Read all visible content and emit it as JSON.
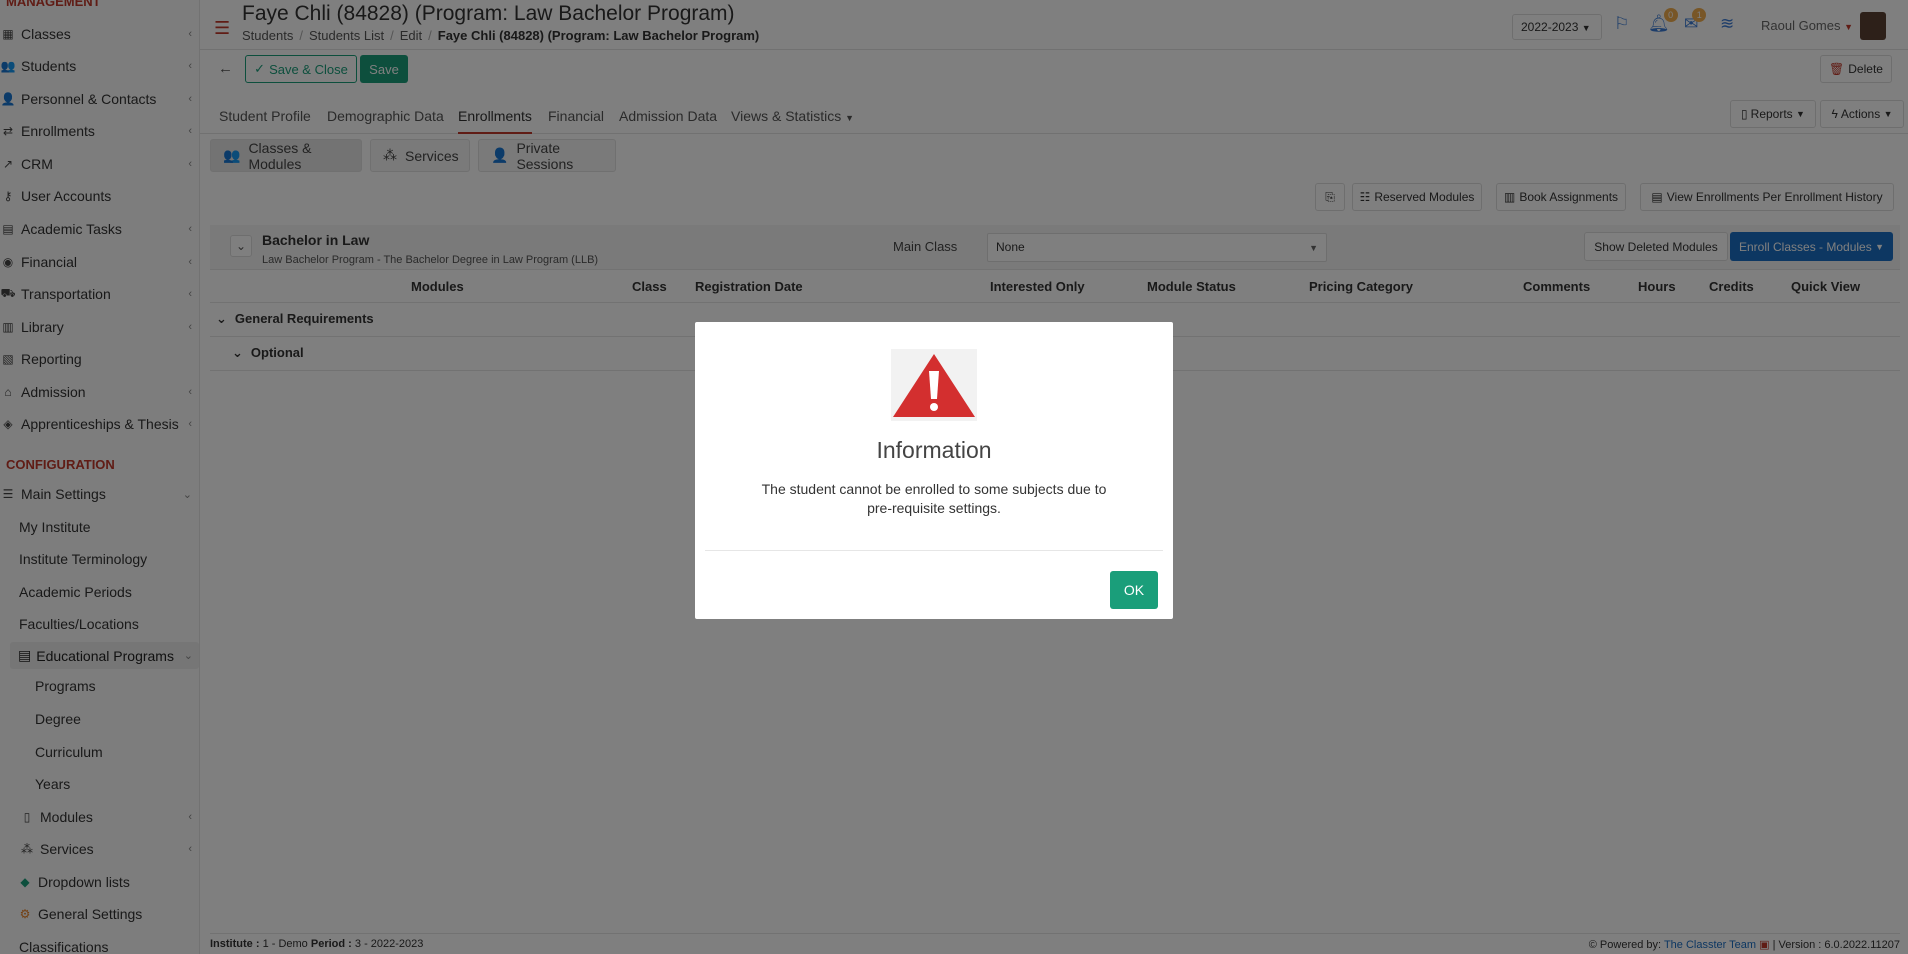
{
  "sidebar": {
    "management_title": "MANAGEMENT",
    "management_items": [
      {
        "label": "Classes"
      },
      {
        "label": "Students"
      },
      {
        "label": "Personnel & Contacts"
      },
      {
        "label": "Enrollments"
      },
      {
        "label": "CRM"
      },
      {
        "label": "User Accounts"
      },
      {
        "label": "Academic Tasks"
      },
      {
        "label": "Financial"
      },
      {
        "label": "Transportation"
      },
      {
        "label": "Library"
      },
      {
        "label": "Reporting"
      },
      {
        "label": "Admission"
      },
      {
        "label": "Apprenticeships & Thesis"
      }
    ],
    "configuration_title": "CONFIGURATION",
    "main_settings": "Main Settings",
    "main_settings_children": [
      "My Institute",
      "Institute Terminology",
      "Academic Periods",
      "Faculties/Locations"
    ],
    "educational_programs": "Educational Programs",
    "educational_children": [
      "Programs",
      "Degree",
      "Curriculum",
      "Years"
    ],
    "modules": "Modules",
    "services": "Services",
    "dropdown_lists": "Dropdown lists",
    "general_settings": "General Settings",
    "classifications": "Classifications"
  },
  "header": {
    "title": "Faye Chli (84828) (Program: Law Bachelor Program)",
    "breadcrumb": [
      "Students",
      "Students List",
      "Edit",
      "Faye Chli (84828) (Program: Law Bachelor Program)"
    ],
    "year": "2022-2023",
    "notif_count": "0",
    "mail_count": "1",
    "user_name": "Raoul Gomes"
  },
  "toolbar": {
    "save_close": "Save & Close",
    "save": "Save",
    "delete": "Delete"
  },
  "tabs": [
    "Student Profile",
    "Demographic Data",
    "Enrollments",
    "Financial",
    "Admission Data",
    "Views & Statistics"
  ],
  "tab_buttons": {
    "reports": "Reports",
    "actions": "Actions"
  },
  "subtabs": [
    "Classes & Modules",
    "Services",
    "Private Sessions"
  ],
  "action_buttons": {
    "reserved": "Reserved Modules",
    "book": "Book Assignments",
    "history": "View Enrollments Per Enrollment History"
  },
  "program": {
    "title": "Bachelor in Law",
    "subtitle": "Law Bachelor Program - The Bachelor Degree in Law Program (LLB)",
    "main_class_label": "Main Class",
    "main_class_value": "None",
    "show_deleted": "Show Deleted Modules",
    "enroll": "Enroll Classes - Modules"
  },
  "table": {
    "headers": [
      "Modules",
      "Class",
      "Registration Date",
      "Interested Only",
      "Module Status",
      "Pricing Category",
      "Comments",
      "Hours",
      "Credits",
      "Quick View"
    ],
    "groups": [
      "General Requirements",
      "Optional"
    ]
  },
  "footer": {
    "institute_label": "Institute :",
    "institute_value": "1 - Demo",
    "period_label": "Period :",
    "period_value": "3 - 2022-2023",
    "powered": "Powered by:",
    "team": "The Classter Team",
    "version": "| Version : 6.0.2022.11207"
  },
  "modal": {
    "title": "Information",
    "message": "The student cannot be enrolled to some subjects due to pre-requisite settings.",
    "ok": "OK",
    "icon": "warning-triangle-icon"
  },
  "colors": {
    "accent_red": "#c0392b",
    "green": "#1a9e7a",
    "blue": "#1a6fc4",
    "warning_red": "#d32f2f"
  }
}
